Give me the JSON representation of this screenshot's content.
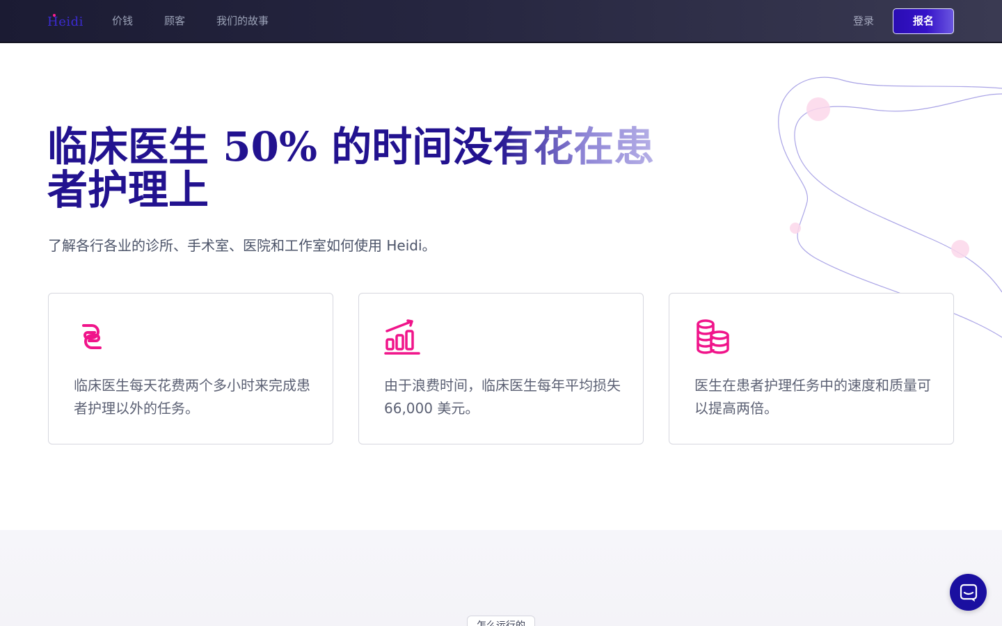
{
  "nav": {
    "logo_text": "Heidi",
    "links": [
      "价钱",
      "顾客",
      "我们的故事"
    ],
    "login": "登录",
    "signup": "报名"
  },
  "hero": {
    "headline_line1": "临床医生 50% 的时间没有花在患",
    "headline_line2": "者护理上",
    "subtitle": "了解各行各业的诊所、手术室、医院和工作室如何使用 Heidi。"
  },
  "cards": [
    {
      "icon": "link-icon",
      "text": "临床医生每天花费两个多小时来完成患者护理以外的任务。"
    },
    {
      "icon": "bar-chart-icon",
      "text": "由于浪费时间，临床医生每年平均损失 66,000 美元。"
    },
    {
      "icon": "coins-icon",
      "text": "医生在患者护理任务中的速度和质量可以提高两倍。"
    }
  ],
  "section2": {
    "badge": "怎么运行的"
  },
  "colors": {
    "brand_dark": "#22128f",
    "accent_pink": "#ff1f8f",
    "nav_bg": "#1b1b33",
    "chat_button": "#1a0fa0"
  }
}
